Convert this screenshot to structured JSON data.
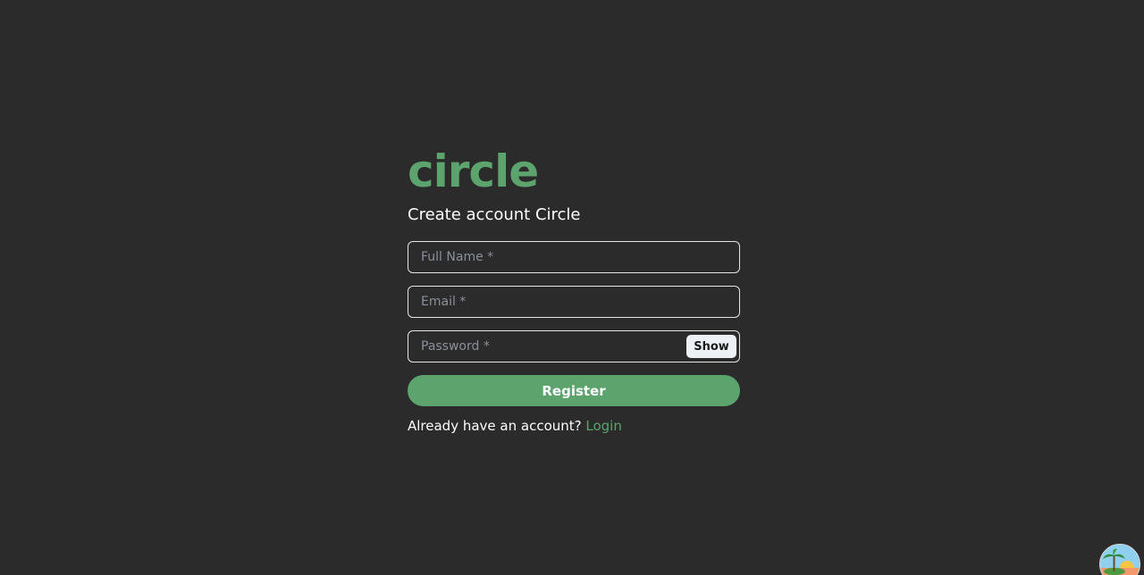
{
  "brand": {
    "logo_text": "circle",
    "accent_color": "#5ca36d"
  },
  "form": {
    "title": "Create account Circle",
    "full_name_placeholder": "Full Name *",
    "email_placeholder": "Email *",
    "password_placeholder": "Password *",
    "show_label": "Show",
    "register_label": "Register"
  },
  "footer": {
    "prompt": "Already have an account? ",
    "login_label": "Login"
  },
  "corner_avatar": {
    "icon": "beach-island-avatar-icon"
  }
}
